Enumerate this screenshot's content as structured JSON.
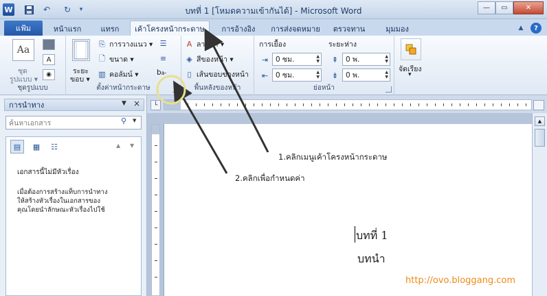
{
  "window": {
    "title": "บทที่ 1 [โหมดความเข้ากันได้] - Microsoft Word",
    "logo_letter": "W"
  },
  "quick_access": [
    "save-icon",
    "undo-icon",
    "redo-icon",
    "customize-icon"
  ],
  "window_controls": {
    "minimize": "—",
    "maximize": "▭",
    "close": "✕"
  },
  "tabs": {
    "file": "แฟ้ม",
    "items": [
      "หน้าแรก",
      "แทรก",
      "เค้าโครงหน้ากระดาษ",
      "การอ้างอิง",
      "การส่งจดหมาย",
      "ตรวจทาน",
      "มุมมอง"
    ],
    "active_index": 2
  },
  "ribbon": {
    "themes": {
      "group_label": "ชุดรูปแบบ",
      "button_label_1": "ชุด",
      "button_label_2": "รูปแบบ ▾",
      "preview_text": "Aa"
    },
    "page_setup": {
      "group_label": "ตั้งค่าหน้ากระดาษ",
      "margins_label_1": "ระยะ",
      "margins_label_2": "ขอบ ▾",
      "orientation": "การวางแนว ▾",
      "size": "ขนาด ▾",
      "columns": "คอลัมน์ ▾",
      "breaks_glyph": "b",
      "breaks_suffix": "a-"
    },
    "page_background": {
      "group_label": "พื้นหลังของหน้า",
      "watermark": "ลายน้ำ ▾",
      "page_color": "สีของหน้า ▾",
      "page_borders": "เส้นขอบของหน้า"
    },
    "paragraph": {
      "group_label": "ย่อหน้า",
      "indent_label": "การเยื้อง",
      "spacing_label": "ระยะห่าง",
      "indent_left": "0 ซม.",
      "indent_right": "0 ซม.",
      "spacing_before": "0 พ.",
      "spacing_after": "0 พ."
    },
    "arrange": {
      "label": "จัดเรียง",
      "dropdown": "▾"
    }
  },
  "nav_pane": {
    "title": "การนำทาง",
    "menu_glyph": "▼",
    "close_glyph": "×",
    "search_placeholder": "ค้นหาเอกสาร",
    "search_drop": "▼",
    "empty_title": "เอกสารนี้ไม่มีหัวเรื่อง",
    "message_lines": [
      "เมื่อต้องการสร้างแท็บการนำทาง",
      "ให้สร้างหัวเรื่องในเอกสารของ",
      "คุณโดยนำลักษณะหัวเรื่องไปใช้"
    ],
    "up_arrow": "▲",
    "down_arrow": "▼"
  },
  "document": {
    "heading_line1": "บทที่ 1",
    "heading_line2": "บทนำ"
  },
  "annotations": {
    "step1": "1.คลิกเมนูเค้าโครงหน้ากระดาษ",
    "step2": "2.คลิกเพื่อกำหนดค่า"
  },
  "watermark_text": "http://ovo.bloggang.com",
  "scrollbar": {
    "up": "▲"
  },
  "colors": {
    "file_tab": "#2459a8",
    "accent": "#2b579a",
    "watermark": "#f0891a",
    "highlight_circle": "#e8e08a"
  }
}
